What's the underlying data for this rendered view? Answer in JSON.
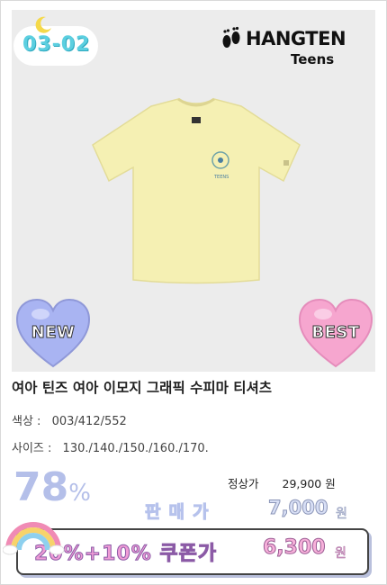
{
  "date_badge": "03-02",
  "brand": {
    "name": "HANGTEN",
    "sub": "Teens"
  },
  "badges": {
    "new": "NEW",
    "best": "BEST"
  },
  "product": {
    "title": "여아 틴즈 여아 이모지 그래픽 수피마 티셔츠",
    "color_label": "색상 :",
    "color_value": "003/412/552",
    "size_label": "사이즈 :",
    "size_value": "130./140./150./160./170."
  },
  "price": {
    "discount_number": "78",
    "discount_unit": "%",
    "regular_label": "정상가",
    "regular_value": "29,900 원",
    "sale_label": "판매가",
    "sale_value": "7,000",
    "sale_unit": "원",
    "coupon_label": "20%+10% 쿠폰가",
    "coupon_value": "6,300",
    "coupon_unit": "원"
  },
  "colors": {
    "shirt": "#f5f0b3",
    "discount": "#b4bfe9",
    "date_text": "#5ccfe0",
    "coupon_text": "#ef9cd6"
  },
  "icons": [
    "moon-icon",
    "footprints-icon",
    "tshirt-image",
    "heart-new-badge",
    "heart-best-badge",
    "rainbow-icon"
  ]
}
